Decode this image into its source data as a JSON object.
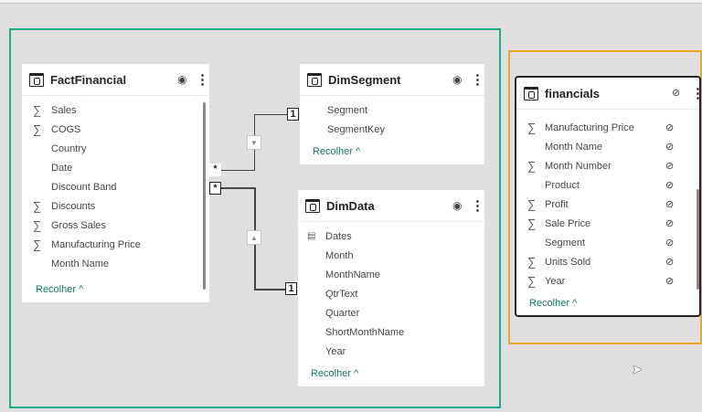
{
  "collapse_label": "Recolher ^",
  "tables": [
    {
      "name": "FactFinancial",
      "fields": [
        {
          "label": "Sales",
          "sum": true
        },
        {
          "label": "COGS",
          "sum": true
        },
        {
          "label": "Country",
          "sum": false
        },
        {
          "label": "Date",
          "sum": false
        },
        {
          "label": "Discount Band",
          "sum": false
        },
        {
          "label": "Discounts",
          "sum": true
        },
        {
          "label": "Gross Sales",
          "sum": true
        },
        {
          "label": "Manufacturing Price",
          "sum": true
        },
        {
          "label": "Month Name",
          "sum": false
        }
      ]
    },
    {
      "name": "DimSegment",
      "fields": [
        {
          "label": "Segment",
          "sum": false
        },
        {
          "label": "SegmentKey",
          "sum": false
        }
      ]
    },
    {
      "name": "DimData",
      "fields": [
        {
          "label": "Dates",
          "sum": false,
          "icon": "calendar"
        },
        {
          "label": "Month"
        },
        {
          "label": "MonthName"
        },
        {
          "label": "QtrText"
        },
        {
          "label": "Quarter"
        },
        {
          "label": "ShortMonthName"
        },
        {
          "label": "Year"
        }
      ]
    },
    {
      "name": "financials",
      "fields": [
        {
          "label": "Manufacturing Price",
          "sum": true
        },
        {
          "label": "Month Name",
          "sum": false
        },
        {
          "label": "Month Number",
          "sum": true
        },
        {
          "label": "Product",
          "sum": false
        },
        {
          "label": "Profit",
          "sum": true
        },
        {
          "label": "Sale Price",
          "sum": true
        },
        {
          "label": "Segment",
          "sum": false
        },
        {
          "label": "Units Sold",
          "sum": true
        },
        {
          "label": "Year",
          "sum": true
        }
      ]
    }
  ],
  "relationships": [
    {
      "from": "FactFinancial",
      "to": "DimSegment",
      "from_card": "*",
      "to_card": "1"
    },
    {
      "from": "FactFinancial",
      "to": "DimData",
      "from_card": "*",
      "to_card": "1"
    }
  ],
  "colors": {
    "selection_green": "#1aab8a",
    "selection_orange": "#e8a82a",
    "link": "#117865"
  }
}
